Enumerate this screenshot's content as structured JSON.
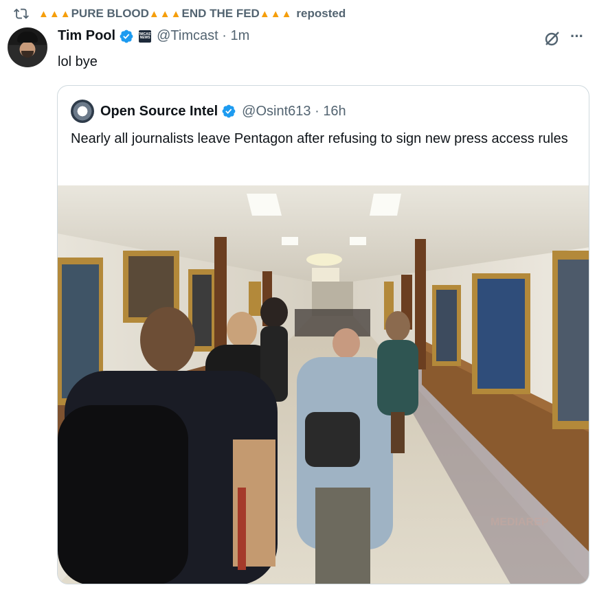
{
  "repost": {
    "icon": "repost-icon",
    "segments": [
      {
        "flames": 3,
        "text": "PURE BLOOD"
      },
      {
        "flames": 3,
        "text": "END THE FED"
      },
      {
        "flames": 3,
        "text": ""
      }
    ],
    "label": "reposted",
    "flame_color": "#f59e0b"
  },
  "author": {
    "name": "Tim Pool",
    "handle": "@Timcast",
    "time": "1m",
    "separator": "·",
    "affiliate_badge_text": "TIMCAST NEWS"
  },
  "tweet": {
    "text": "lol bye"
  },
  "actions": {
    "grok_icon": "grok-icon",
    "more_icon": "more-icon"
  },
  "quote": {
    "name": "Open Source Intel",
    "handle": "@Osint613",
    "separator": "·",
    "time": "16h",
    "text": "Nearly all journalists leave Pentagon after refusing to sign new press access rules",
    "image_alt": "Journalists walking down a long Pentagon hallway lined with portraits",
    "watermark": "MEDIAREP"
  },
  "colors": {
    "verified_blue": "#1d9bf0",
    "text": "#0f1419",
    "secondary": "#536471",
    "border": "#cfd9de"
  }
}
